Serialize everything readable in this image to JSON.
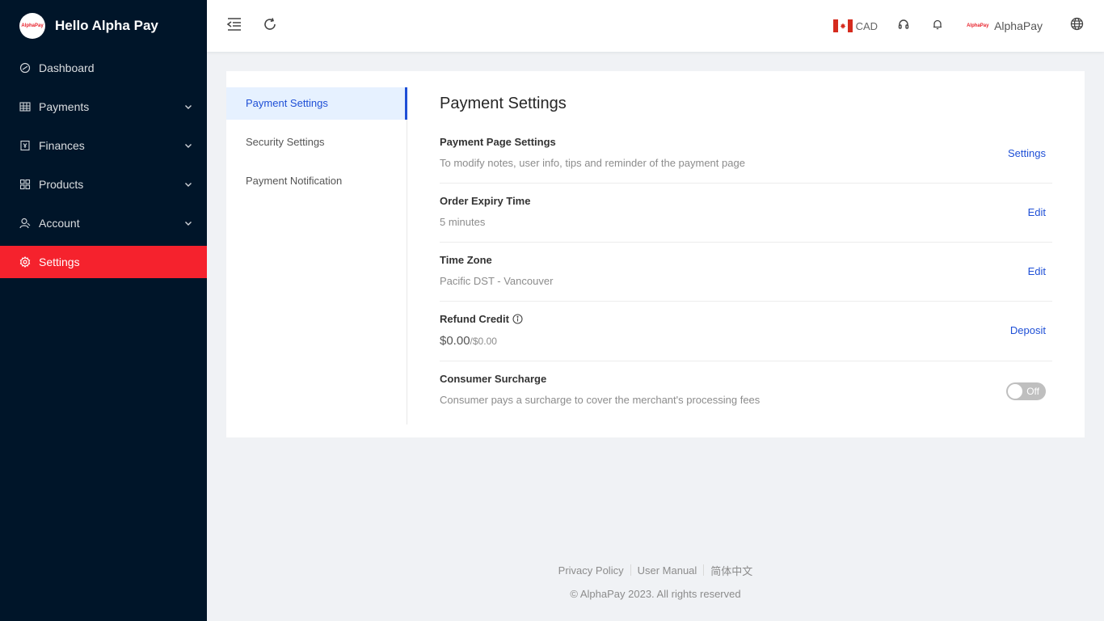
{
  "brand": {
    "logo_text": "AlphaPay",
    "title": "Hello Alpha Pay"
  },
  "sidebar": {
    "items": [
      {
        "label": "Dashboard",
        "icon": "dashboard-icon",
        "has_submenu": false
      },
      {
        "label": "Payments",
        "icon": "table-icon",
        "has_submenu": true
      },
      {
        "label": "Finances",
        "icon": "finance-icon",
        "has_submenu": true
      },
      {
        "label": "Products",
        "icon": "grid-icon",
        "has_submenu": true
      },
      {
        "label": "Account",
        "icon": "user-icon",
        "has_submenu": true
      },
      {
        "label": "Settings",
        "icon": "gear-icon",
        "has_submenu": false,
        "active": true
      }
    ]
  },
  "header": {
    "currency": "CAD",
    "user_logo_text": "AlphaPay",
    "user_name": "AlphaPay"
  },
  "subnav": {
    "items": [
      {
        "label": "Payment Settings",
        "active": true
      },
      {
        "label": "Security Settings"
      },
      {
        "label": "Payment Notification"
      }
    ]
  },
  "panel": {
    "title": "Payment Settings",
    "rows": [
      {
        "title": "Payment Page Settings",
        "desc": "To modify notes, user info, tips and reminder of the payment page",
        "action": "Settings"
      },
      {
        "title": "Order Expiry Time",
        "desc": "5 minutes",
        "action": "Edit"
      },
      {
        "title": "Time Zone",
        "desc": "Pacific DST - Vancouver",
        "action": "Edit"
      },
      {
        "title": "Refund Credit",
        "amount": "$0.00",
        "amount_total": "/$0.00",
        "action": "Deposit"
      },
      {
        "title": "Consumer Surcharge",
        "desc": "Consumer pays a surcharge to cover the merchant's processing fees",
        "toggle_label": "Off"
      }
    ]
  },
  "footer": {
    "links": [
      "Privacy Policy",
      "User Manual",
      "简体中文"
    ],
    "copyright": "© AlphaPay 2023. All rights reserved"
  },
  "colors": {
    "sidebar_bg": "#001529",
    "active_menu": "#f5222d",
    "link": "#1e4fd6"
  }
}
